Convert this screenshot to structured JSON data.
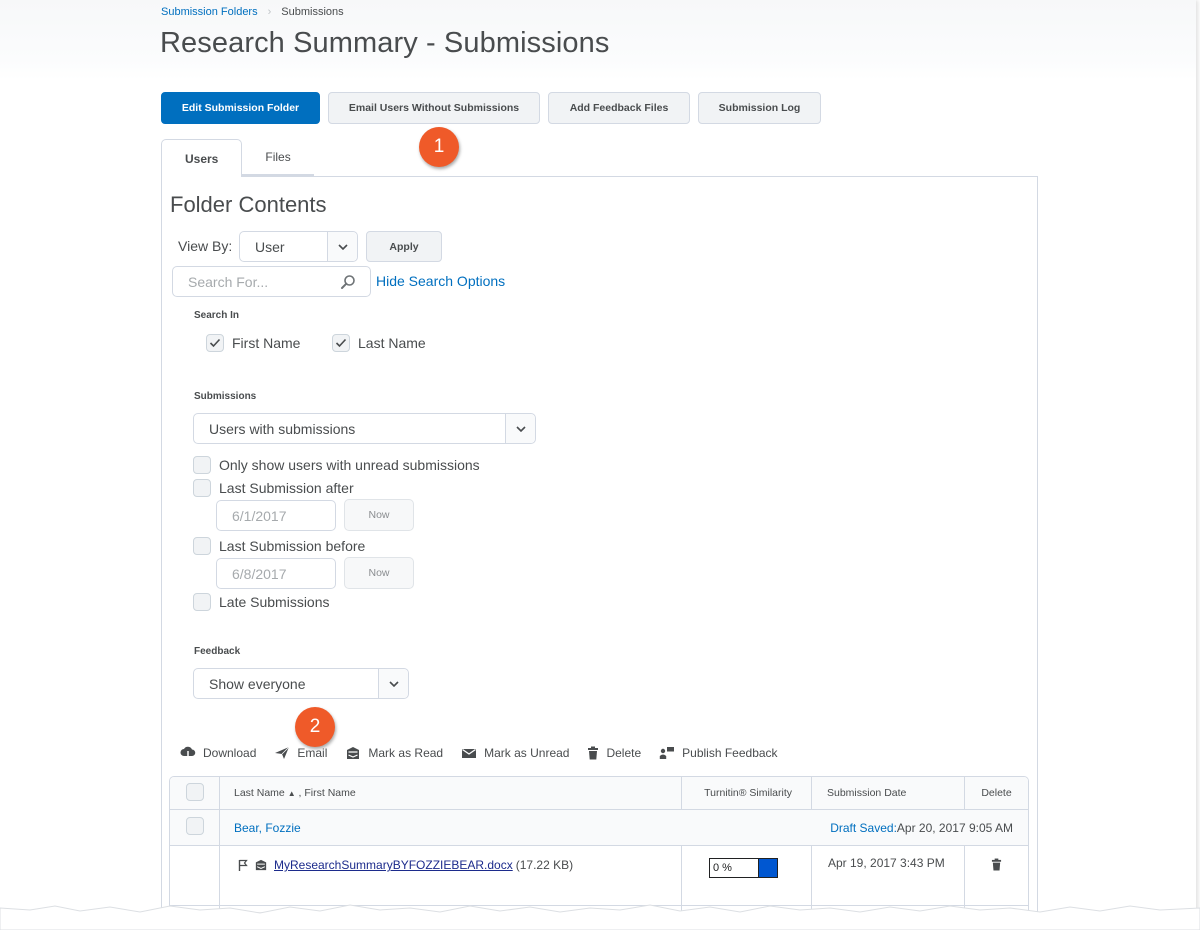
{
  "breadcrumb": {
    "parent": "Submission Folders",
    "current": "Submissions"
  },
  "page_title": "Research Summary - Submissions",
  "actions": {
    "edit_folder": "Edit Submission Folder",
    "email_without": "Email Users Without Submissions",
    "add_feedback": "Add Feedback Files",
    "submission_log": "Submission Log"
  },
  "callouts": {
    "one": "1",
    "two": "2"
  },
  "tabs": [
    {
      "label": "Users",
      "active": true
    },
    {
      "label": "Files",
      "active": false
    }
  ],
  "folder": {
    "heading": "Folder Contents",
    "view_by_label": "View By:",
    "view_by_value": "User",
    "apply": "Apply",
    "search_placeholder": "Search For...",
    "hide_search": "Hide Search Options"
  },
  "search_in": {
    "label": "Search In",
    "options": [
      {
        "label": "First Name",
        "checked": true
      },
      {
        "label": "Last Name",
        "checked": true
      }
    ]
  },
  "submissions_filter": {
    "label": "Submissions",
    "value": "Users with submissions",
    "unread_only": {
      "label": "Only show users with unread submissions",
      "checked": false
    },
    "after": {
      "label": "Last Submission after",
      "checked": false,
      "date": "6/1/2017",
      "now": "Now"
    },
    "before": {
      "label": "Last Submission before",
      "checked": false,
      "date": "6/8/2017",
      "now": "Now"
    },
    "late": {
      "label": "Late Submissions",
      "checked": false
    }
  },
  "feedback_filter": {
    "label": "Feedback",
    "value": "Show everyone"
  },
  "toolbar": [
    {
      "label": "Download",
      "icon": "download-icon"
    },
    {
      "label": "Email",
      "icon": "email-send-icon"
    },
    {
      "label": "Mark as Read",
      "icon": "mark-read-icon"
    },
    {
      "label": "Mark as Unread",
      "icon": "mark-unread-icon"
    },
    {
      "label": "Delete",
      "icon": "trash-icon"
    },
    {
      "label": "Publish Feedback",
      "icon": "publish-feedback-icon"
    }
  ],
  "table": {
    "headers": {
      "name": "Last Name",
      "name_suffix": ", First Name",
      "similarity": "Turnitin® Similarity",
      "date": "Submission Date",
      "delete": "Delete"
    },
    "rows": [
      {
        "user": "Bear, Fozzie",
        "draft_label": "Draft Saved:",
        "draft_date": "Apr 20, 2017 9:05 AM",
        "file": {
          "name": "MyResearchSummaryBYFOZZIEBEAR.docx",
          "size": "(17.22 KB)",
          "similarity": "0 %",
          "date": "Apr 19, 2017 3:43 PM"
        }
      }
    ]
  },
  "colors": {
    "primary": "#006fbf",
    "callout": "#ef5a29",
    "similarity_bar": "#0057d1"
  }
}
